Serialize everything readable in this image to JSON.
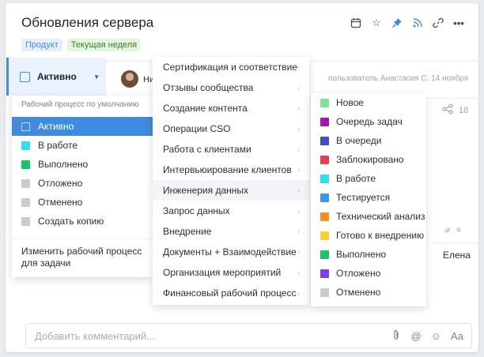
{
  "task": {
    "title": "Обновления сервера",
    "tags": [
      {
        "label": "Продукт",
        "color": "#4a88d8"
      },
      {
        "label": "Текущая неделя",
        "color": "#3e7a31"
      }
    ],
    "status_label": "Активно",
    "assignee_partial": "Ни",
    "activity_text": "пользователь Анастасия С. 14 ноября",
    "share_count": "18",
    "right_cell_name": "Елена"
  },
  "header_icons": [
    "calendar-icon",
    "star-icon",
    "pin-icon",
    "rss-icon",
    "link-icon",
    "more-icon"
  ],
  "status_menu": {
    "caption": "Рабочий процесс по умолчанию",
    "items": [
      {
        "label": "Активно",
        "color": "#3f8be0",
        "active": true
      },
      {
        "label": "В работе",
        "color": "#2ee0f0"
      },
      {
        "label": "Выполнено",
        "color": "#18c46a"
      },
      {
        "label": "Отложено",
        "color": "#c5cad3"
      },
      {
        "label": "Отменено",
        "color": "#c5cad3"
      },
      {
        "label": "Создать копию",
        "color": "#c5cad3"
      }
    ],
    "change_label_line1": "Изменить рабочий процесс",
    "change_label_line2": "для задачи"
  },
  "workflow_menu": {
    "items": [
      {
        "label": "Сертификация и соответствие"
      },
      {
        "label": "Отзывы сообщества"
      },
      {
        "label": "Создание контента"
      },
      {
        "label": "Операции CSO"
      },
      {
        "label": "Работа с клиентами"
      },
      {
        "label": "Интервьюирование клиентов"
      },
      {
        "label": "Инженерия данных",
        "hover": true
      },
      {
        "label": "Запрос данных"
      },
      {
        "label": "Внедрение"
      },
      {
        "label": "Документы + Взаимодействие"
      },
      {
        "label": "Организация мероприятий"
      },
      {
        "label": "Финансовый рабочий процесс"
      }
    ]
  },
  "workflow_statuses": {
    "items": [
      {
        "label": "Новое",
        "color": "#7fe39a"
      },
      {
        "label": "Очередь задач",
        "color": "#a315b5"
      },
      {
        "label": "В очереди",
        "color": "#3f4fc2"
      },
      {
        "label": "Заблокировано",
        "color": "#f03a4f"
      },
      {
        "label": "В работе",
        "color": "#2ee0f0"
      },
      {
        "label": "Тестируется",
        "color": "#3a95ee"
      },
      {
        "label": "Технический анализ",
        "color": "#ff8a1c"
      },
      {
        "label": "Готово к внедрению",
        "color": "#ffd033"
      },
      {
        "label": "Выполнено",
        "color": "#18c46a"
      },
      {
        "label": "Отложено",
        "color": "#7d3ff0"
      },
      {
        "label": "Отменено",
        "color": "#c5cad3"
      }
    ]
  },
  "comment": {
    "placeholder": "Добавить комментарий...",
    "font_label": "Аа"
  }
}
